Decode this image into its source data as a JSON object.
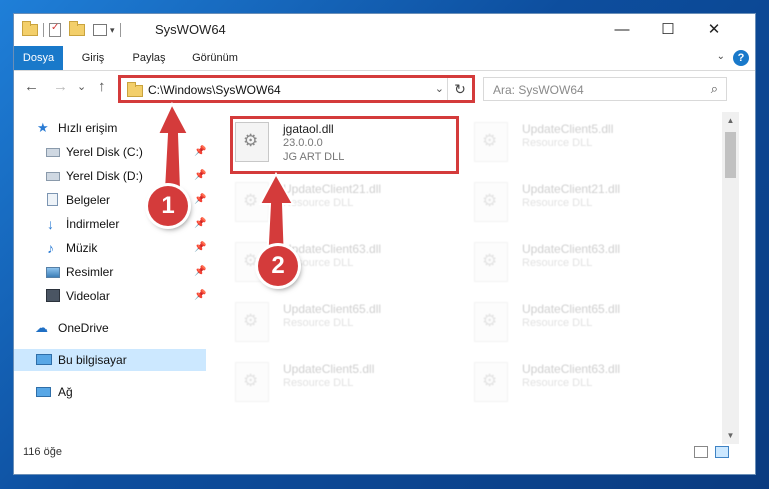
{
  "window": {
    "title": "SysWOW64",
    "buttons": {
      "minimize": "—",
      "maximize": "☐",
      "close": "✕"
    }
  },
  "ribbon": {
    "tabs": [
      "Dosya",
      "Giriş",
      "Paylaş",
      "Görünüm"
    ],
    "active_tab": "Dosya",
    "help": "?"
  },
  "address": {
    "path": "C:\\Windows\\SysWOW64",
    "refresh_icon": "↻",
    "dropdown_icon": "⌄"
  },
  "search": {
    "placeholder": "Ara: SysWOW64",
    "icon": "⌕"
  },
  "nav_buttons": {
    "back": "←",
    "forward": "→",
    "recent": "⌄",
    "up": "↑"
  },
  "sidebar": {
    "items": [
      {
        "label": "Hızlı erişim",
        "icon": "star-icon",
        "pinned": false
      },
      {
        "label": "Yerel Disk (C:)",
        "icon": "drive-icon",
        "pinned": true
      },
      {
        "label": "Yerel Disk (D:)",
        "icon": "drive-icon",
        "pinned": true
      },
      {
        "label": "Belgeler",
        "icon": "documents-icon",
        "pinned": true
      },
      {
        "label": "İndirmeler",
        "icon": "download-icon",
        "pinned": true
      },
      {
        "label": "Müzik",
        "icon": "music-icon",
        "pinned": true
      },
      {
        "label": "Resimler",
        "icon": "pictures-icon",
        "pinned": true
      },
      {
        "label": "Videolar",
        "icon": "videos-icon",
        "pinned": true
      },
      {
        "label": "OneDrive",
        "icon": "cloud-icon",
        "pinned": false
      },
      {
        "label": "Bu bilgisayar",
        "icon": "computer-icon",
        "pinned": false
      },
      {
        "label": "Ağ",
        "icon": "network-icon",
        "pinned": false
      }
    ],
    "selected": "Bu bilgisayar",
    "pin_glyph": "📌"
  },
  "files": [
    {
      "name": "jgataol.dll",
      "version": "23.0.0.0",
      "description": "JG ART DLL"
    },
    {
      "name": "UpdateClient5.dll",
      "version": "",
      "description": "Resource DLL"
    },
    {
      "name": "UpdateClient21.dll",
      "version": "",
      "description": "Resource DLL"
    },
    {
      "name": "UpdateClient21.dll",
      "version": "",
      "description": "Resource DLL"
    },
    {
      "name": "UpdateClient63.dll",
      "version": "",
      "description": "Resource DLL"
    },
    {
      "name": "UpdateClient63.dll",
      "version": "",
      "description": "Resource DLL"
    },
    {
      "name": "UpdateClient65.dll",
      "version": "",
      "description": "Resource DLL"
    },
    {
      "name": "UpdateClient65.dll",
      "version": "",
      "description": "Resource DLL"
    },
    {
      "name": "UpdateClient5.dll",
      "version": "",
      "description": "Resource DLL"
    },
    {
      "name": "UpdateClient63.dll",
      "version": "",
      "description": "Resource DLL"
    }
  ],
  "status": {
    "count": "116 öğe"
  },
  "callouts": {
    "one": "1",
    "two": "2"
  },
  "colors": {
    "accent": "#1979ca",
    "highlight": "#d43b3b",
    "selection": "#cce8ff"
  }
}
